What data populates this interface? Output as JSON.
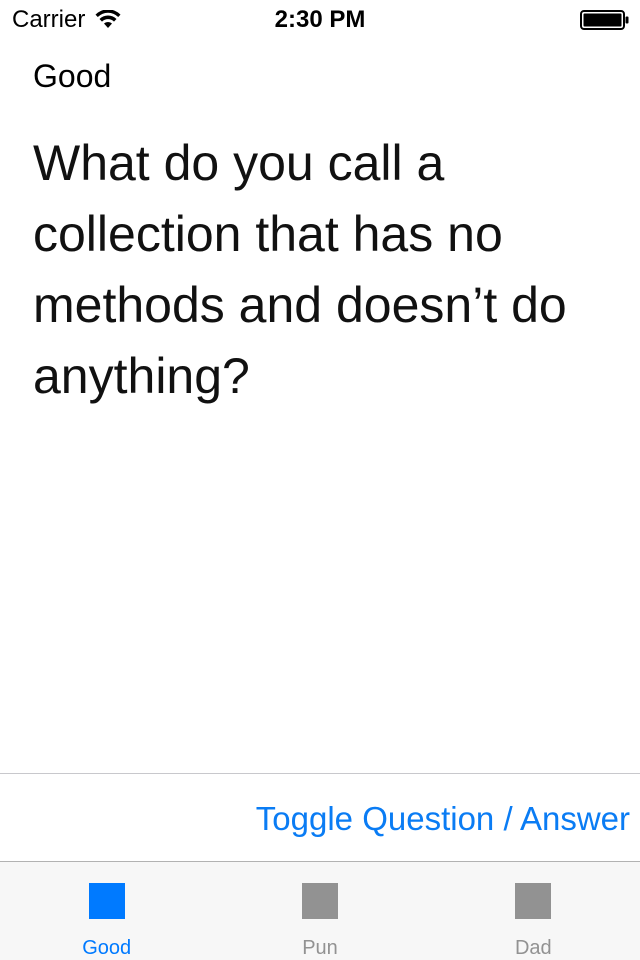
{
  "status_bar": {
    "carrier": "Carrier",
    "time": "2:30 PM"
  },
  "content": {
    "category": "Good",
    "question": "What do you call a collection that has no methods and doesn’t do anything?"
  },
  "toolbar": {
    "toggle_label": "Toggle Question / Answer"
  },
  "tabs": [
    {
      "label": "Good",
      "selected": true,
      "color": "#007aff"
    },
    {
      "label": "Pun",
      "selected": false,
      "color": "#929292"
    },
    {
      "label": "Dad",
      "selected": false,
      "color": "#929292"
    }
  ],
  "colors": {
    "accent": "#007aff",
    "inactive": "#929292"
  }
}
